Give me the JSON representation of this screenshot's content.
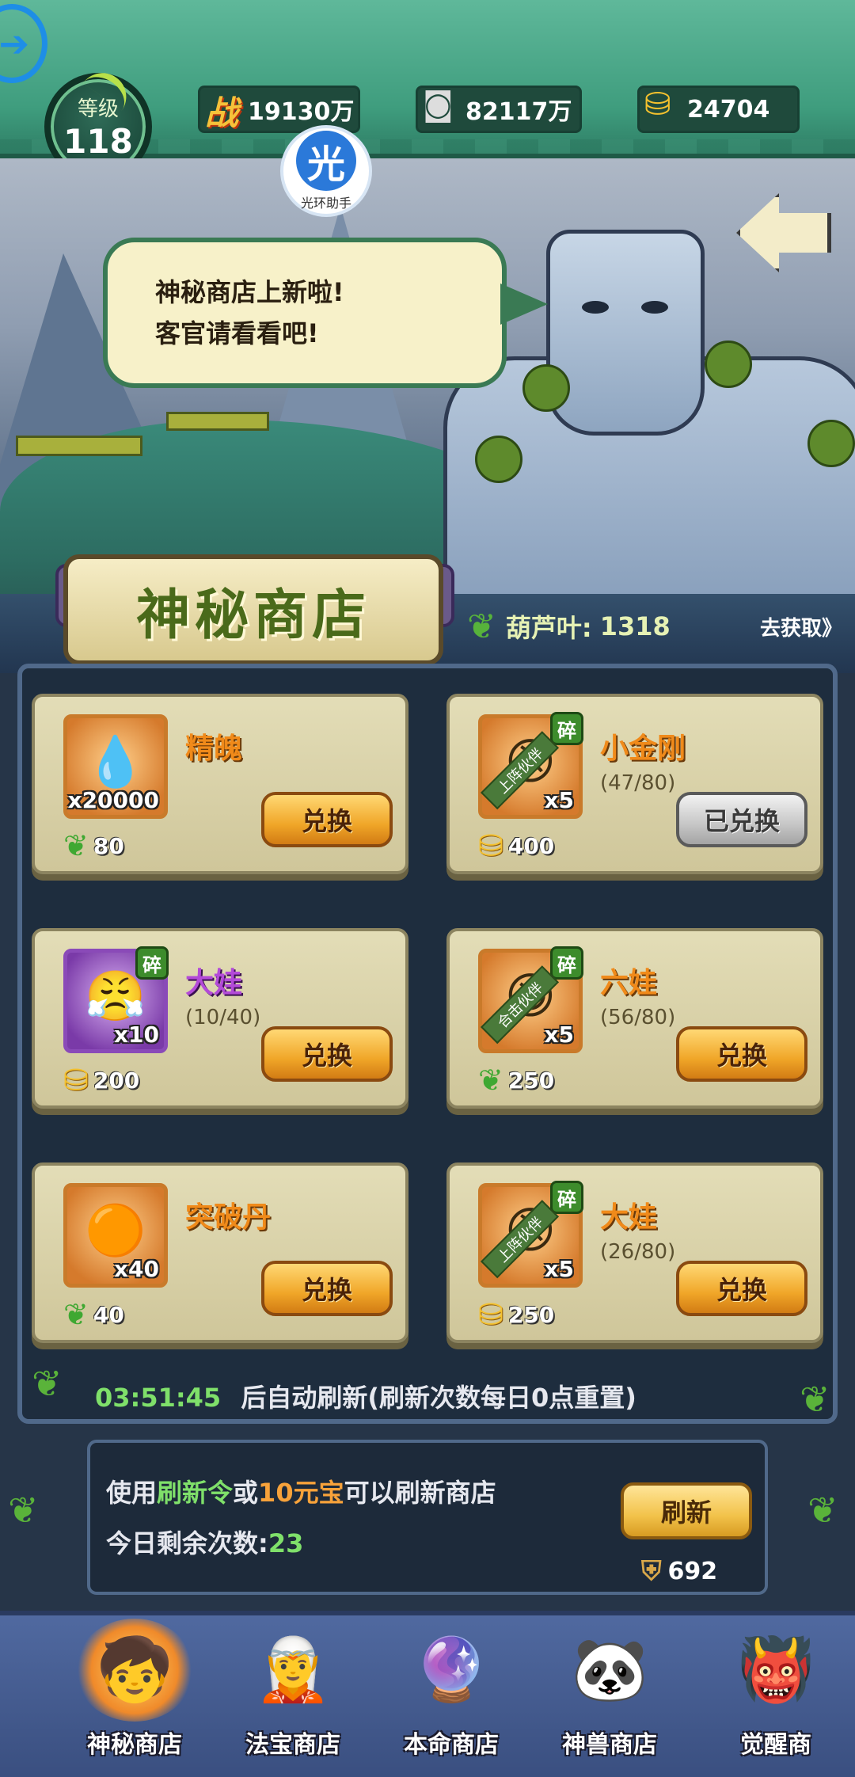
{
  "header": {
    "level_label": "等级",
    "level_value": "118",
    "power_icon": "战",
    "power_value": "19130万",
    "silver_value": "82117万",
    "gold_value": "24704",
    "helper_char": "光",
    "helper_label": "光环助手"
  },
  "scene": {
    "speech_line1": "神秘商店上新啦!",
    "speech_line2": "客官请看看吧!"
  },
  "shop": {
    "title": "神秘商店",
    "leaf_label": "葫芦叶:",
    "leaf_value": "1318",
    "go_get": "去获取》"
  },
  "items": [
    {
      "name": "精魄",
      "qty": "x20000",
      "progress": "",
      "price": "80",
      "currency": "leaf-icon",
      "button": "兑换",
      "fragment": "",
      "ribbon": "",
      "emoji": "💧"
    },
    {
      "name": "小金刚",
      "qty": "x5",
      "progress": "(47/80)",
      "price": "400",
      "currency": "gold-ingot-icon",
      "button": "已兑换",
      "fragment": "碎",
      "ribbon": "上阵伙伴",
      "emoji": "😠"
    },
    {
      "name": "大娃",
      "qty": "x10",
      "progress": "(10/40)",
      "price": "200",
      "currency": "gold-ingot-icon",
      "button": "兑换",
      "fragment": "碎",
      "ribbon": "",
      "emoji": "😤"
    },
    {
      "name": "六娃",
      "qty": "x5",
      "progress": "(56/80)",
      "price": "250",
      "currency": "leaf-icon",
      "button": "兑换",
      "fragment": "碎",
      "ribbon": "合击伙伴",
      "emoji": "😆"
    },
    {
      "name": "突破丹",
      "qty": "x40",
      "progress": "",
      "price": "40",
      "currency": "leaf-icon",
      "button": "兑换",
      "fragment": "",
      "ribbon": "",
      "emoji": "🟠"
    },
    {
      "name": "大娃",
      "qty": "x5",
      "progress": "(26/80)",
      "price": "250",
      "currency": "gold-ingot-icon",
      "button": "兑换",
      "fragment": "碎",
      "ribbon": "上阵伙伴",
      "emoji": "😠"
    }
  ],
  "refresh": {
    "timer": "03:51:45",
    "timer_text": "后自动刷新(刷新次数每日0点重置)",
    "line1_a": "使用",
    "line1_b": "刷新令",
    "line1_c": "或",
    "line1_d": "10元宝",
    "line1_e": "可以刷新商店",
    "line2_a": "今日剩余次数:",
    "line2_b": "23",
    "button": "刷新",
    "token_value": "692"
  },
  "nav": [
    {
      "label": "神秘商店",
      "emoji": "🧒",
      "active": true
    },
    {
      "label": "法宝商店",
      "emoji": "🧝",
      "active": false
    },
    {
      "label": "本命商店",
      "emoji": "🔮",
      "active": false
    },
    {
      "label": "神兽商店",
      "emoji": "🐼",
      "active": false
    },
    {
      "label": "觉醒商",
      "emoji": "👹",
      "active": false
    }
  ],
  "colors": {
    "accent_orange": "#f08a1a",
    "button_gold": "#f0a628",
    "timer_green": "#7fe06a",
    "panel_bg": "#1e2d3e"
  }
}
